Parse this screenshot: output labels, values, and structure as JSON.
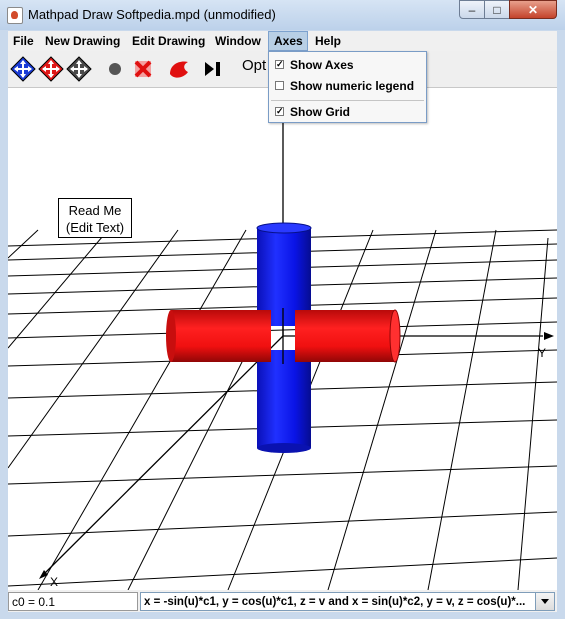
{
  "window": {
    "title": "Mathpad Draw Softpedia.mpd (unmodified)",
    "min_glyph": "–",
    "max_glyph": "□",
    "close_glyph": "✕"
  },
  "menubar": {
    "items": [
      {
        "label": "File"
      },
      {
        "label": "New Drawing"
      },
      {
        "label": "Edit Drawing"
      },
      {
        "label": "Window"
      },
      {
        "label": "Axes"
      },
      {
        "label": "Help"
      }
    ]
  },
  "toolbar": {
    "opt_label": "Opt",
    "icons": [
      "blue-arrows-icon",
      "red-arrows-icon",
      "gray-arrows-icon",
      "dot-icon",
      "red-x-icon",
      "red-shape-icon",
      "play-pause-icon"
    ]
  },
  "axes_menu": {
    "items": [
      {
        "label": "Show Axes",
        "checked": true
      },
      {
        "label": "Show numeric legend",
        "checked": false
      },
      {
        "label": "Show Grid",
        "checked": true
      }
    ]
  },
  "canvas": {
    "note_line1": "Read Me",
    "note_line2": "(Edit Text)",
    "y_axis_label": "Y",
    "x_axis_label": "X",
    "colors": {
      "cylinder_blue": "#0a14e6",
      "cylinder_red": "#f01010",
      "grid": "#000000"
    }
  },
  "status": {
    "left_value": "c0 = 0.1",
    "expression": "x = -sin(u)*c1, y = cos(u)*c1, z = v and x = sin(u)*c2, y = v, z = cos(u)*..."
  }
}
